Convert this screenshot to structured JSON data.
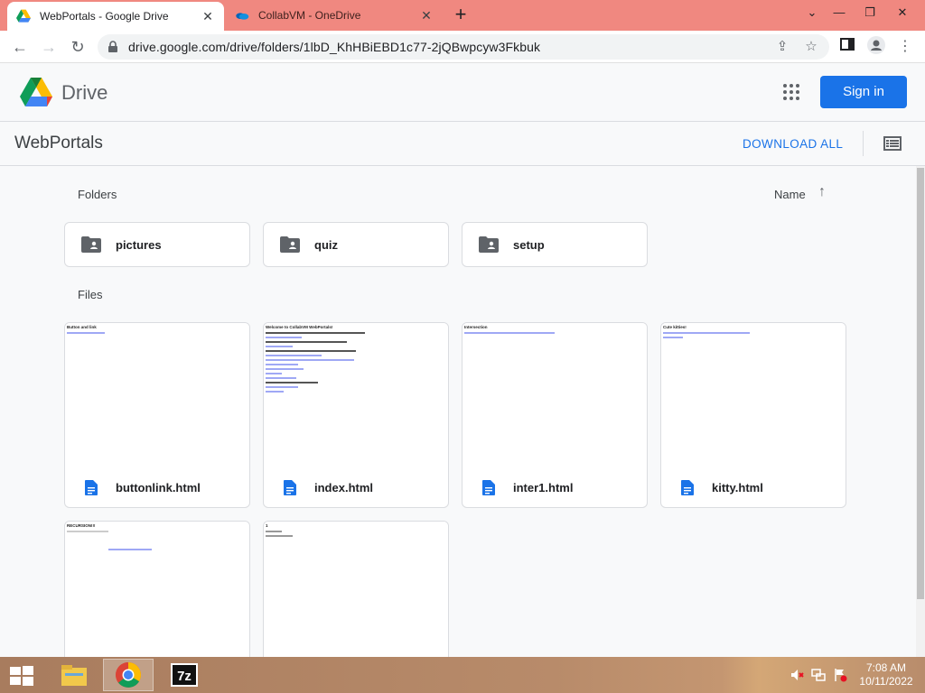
{
  "browser": {
    "tabs": [
      {
        "title": "WebPortals - Google Drive",
        "active": true
      },
      {
        "title": "CollabVM - OneDrive",
        "active": false
      }
    ],
    "url": "drive.google.com/drive/folders/1lbD_KhHBiEBD1c77-2jQBwpcyw3Fkbuk"
  },
  "drive": {
    "logo_text": "Drive",
    "sign_in_label": "Sign in"
  },
  "folder": {
    "title": "WebPortals",
    "download_all_label": "DOWNLOAD ALL",
    "folders_label": "Folders",
    "files_label": "Files",
    "sort_label": "Name",
    "folders": [
      {
        "name": "pictures"
      },
      {
        "name": "quiz"
      },
      {
        "name": "setup"
      }
    ],
    "files": [
      {
        "name": "buttonlink.html",
        "thumb_title": "Button and link"
      },
      {
        "name": "index.html",
        "thumb_title": "Welcome to CollabVM WebPortals!"
      },
      {
        "name": "inter1.html",
        "thumb_title": "Intersection"
      },
      {
        "name": "kitty.html",
        "thumb_title": "Cute kitties!"
      },
      {
        "name": "",
        "thumb_title": "RECURSION!!!"
      },
      {
        "name": "",
        "thumb_title": "1"
      }
    ]
  },
  "taskbar": {
    "time": "7:08 AM",
    "date": "10/11/2022"
  },
  "colors": {
    "tabstrip": "#f08880",
    "accent": "#1a73e8"
  }
}
